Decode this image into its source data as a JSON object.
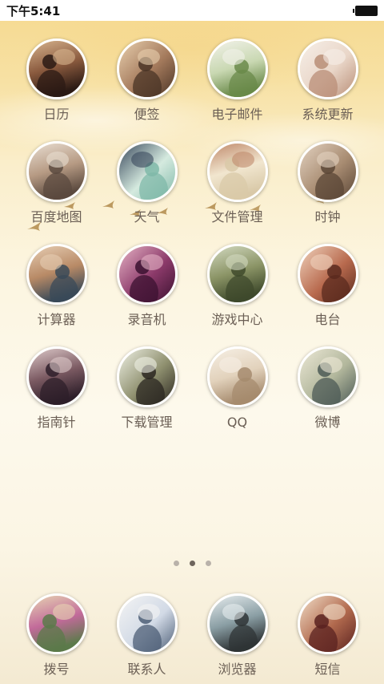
{
  "status_bar": {
    "time": "下午5:41",
    "battery_icon": "battery-icon"
  },
  "apps": [
    {
      "label": "日历",
      "name": "calendar",
      "colors": [
        "#2b1a14",
        "#8a5a3e",
        "#d7b48e"
      ]
    },
    {
      "label": "便签",
      "name": "notes",
      "colors": [
        "#4a3426",
        "#a47a5c",
        "#e8cfae"
      ]
    },
    {
      "label": "电子邮件",
      "name": "email",
      "colors": [
        "#6a8a4a",
        "#c9d8b2",
        "#f2f2ea"
      ]
    },
    {
      "label": "系统更新",
      "name": "system-update",
      "colors": [
        "#b98e77",
        "#e9d6c8",
        "#f6efe8"
      ]
    },
    {
      "label": "百度地图",
      "name": "baidu-map",
      "colors": [
        "#5b4a3f",
        "#b69a83",
        "#e8ddd1"
      ]
    },
    {
      "label": "天气",
      "name": "weather",
      "colors": [
        "#7fb8a8",
        "#d5eadf",
        "#3b4a5e"
      ]
    },
    {
      "label": "文件管理",
      "name": "file-manager",
      "colors": [
        "#d9c9a8",
        "#f1e6cf",
        "#c08a6c"
      ]
    },
    {
      "label": "时钟",
      "name": "clock",
      "colors": [
        "#5a4636",
        "#a88c72",
        "#e3d2c0"
      ]
    },
    {
      "label": "计算器",
      "name": "calculator",
      "colors": [
        "#3a4a58",
        "#b88a66",
        "#e6cdb3"
      ]
    },
    {
      "label": "录音机",
      "name": "recorder",
      "colors": [
        "#3b1230",
        "#8c3a6a",
        "#e5b2c4"
      ]
    },
    {
      "label": "游戏中心",
      "name": "game-center",
      "colors": [
        "#3f4a2c",
        "#8b9466",
        "#d2d9c0"
      ]
    },
    {
      "label": "电台",
      "name": "radio",
      "colors": [
        "#5a2a1e",
        "#b86a4e",
        "#f0d2bc"
      ]
    },
    {
      "label": "指南针",
      "name": "compass",
      "colors": [
        "#2e1f2a",
        "#7b5a62",
        "#dcc8c8"
      ]
    },
    {
      "label": "下载管理",
      "name": "download-manager",
      "colors": [
        "#2a2620",
        "#8e8f6e",
        "#eef0e4"
      ]
    },
    {
      "label": "QQ",
      "name": "qq",
      "colors": [
        "#a68b6e",
        "#e2d2bc",
        "#f6efe4"
      ]
    },
    {
      "label": "微博",
      "name": "weibo",
      "colors": [
        "#4c5a56",
        "#b2b79c",
        "#ece8d6"
      ]
    }
  ],
  "page_indicator": {
    "count": 3,
    "active_index": 1
  },
  "dock": [
    {
      "label": "拨号",
      "name": "dialer",
      "colors": [
        "#5b7a4a",
        "#c26a9a",
        "#e7d4b2"
      ]
    },
    {
      "label": "联系人",
      "name": "contacts",
      "colors": [
        "#4c5e76",
        "#d2dae6",
        "#f4f4f4"
      ]
    },
    {
      "label": "浏览器",
      "name": "browser",
      "colors": [
        "#2f3436",
        "#8a9ea4",
        "#e6ecee"
      ]
    },
    {
      "label": "短信",
      "name": "messages",
      "colors": [
        "#5a2220",
        "#b26a4e",
        "#f0dcc6"
      ]
    }
  ]
}
